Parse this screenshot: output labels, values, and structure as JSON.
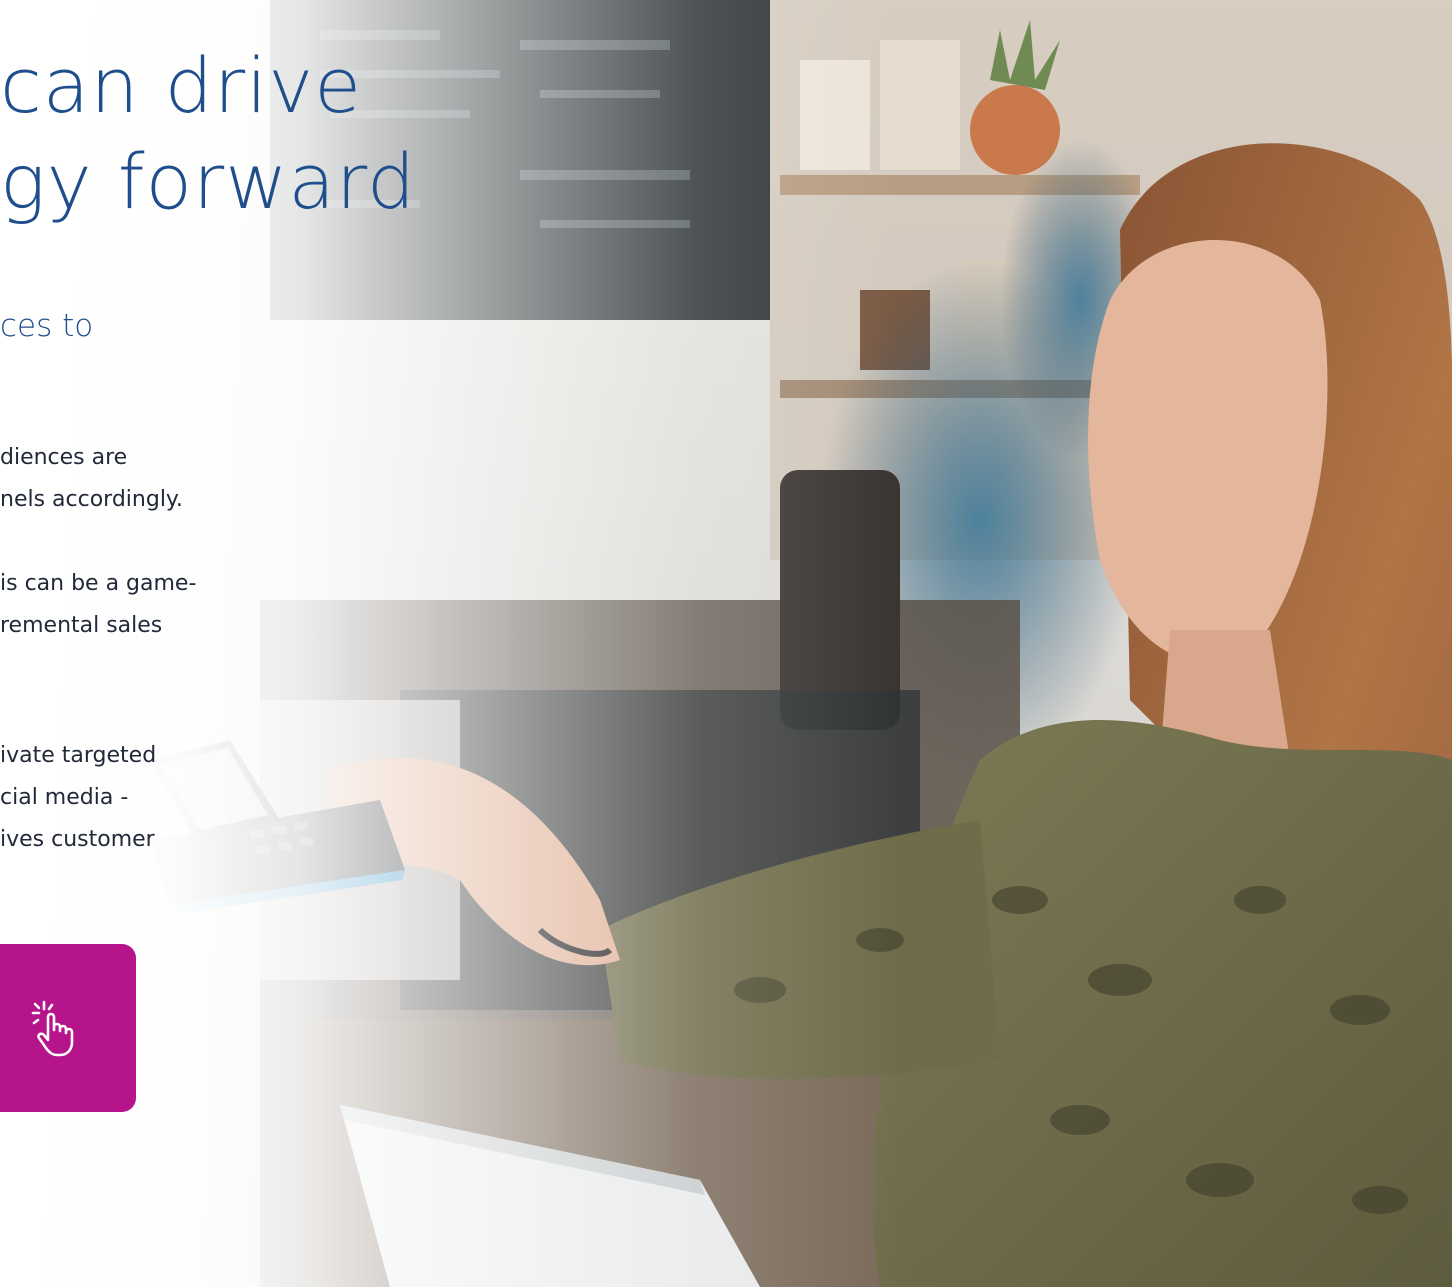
{
  "hero": {
    "headline": [
      "can drive",
      "gy forward"
    ],
    "subhead": "ces to",
    "paragraphs": [
      [
        "diences are",
        "nels accordingly."
      ],
      [
        "is can be a game-",
        "remental sales"
      ],
      [
        "ivate targeted",
        "cial media -",
        "ives customer"
      ]
    ],
    "photo": "barista-taking-contactless-payment",
    "cta_icon": "hand-pointer-click-icon",
    "colors": {
      "headline": "#1f4e8c",
      "body_text": "#222a3a",
      "cta_background": "#b5148a"
    }
  }
}
